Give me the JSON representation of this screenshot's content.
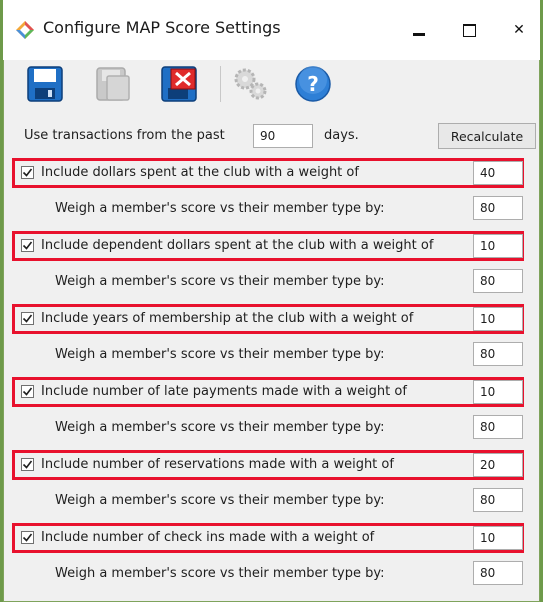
{
  "window": {
    "title": "Configure MAP Score Settings",
    "buttons": {
      "minimize": "▬",
      "maximize": "☐",
      "close": "✕"
    }
  },
  "toolbar": {
    "items": [
      {
        "icon": "save-icon",
        "enabled": true
      },
      {
        "icon": "save-copy-icon",
        "enabled": false
      },
      {
        "icon": "delete-icon",
        "enabled": true
      },
      {
        "icon": "gears-icon",
        "enabled": false
      },
      {
        "icon": "help-icon",
        "enabled": true
      }
    ]
  },
  "transactions": {
    "prefix": "Use transactions from the past",
    "value": "90",
    "suffix": "days.",
    "recalculate_label": "Recalculate"
  },
  "criteria": [
    {
      "label": "Include dollars spent at the club with a weight of",
      "checked": true,
      "weight": "40",
      "sub_label": "Weigh a member's score vs their member type by:",
      "sub_value": "80"
    },
    {
      "label": "Include dependent dollars spent at the club with a weight of",
      "checked": true,
      "weight": "10",
      "sub_label": "Weigh a member's score vs their member type by:",
      "sub_value": "80"
    },
    {
      "label": "Include years of membership at the club with a weight of",
      "checked": true,
      "weight": "10",
      "sub_label": "Weigh a member's score vs their member type by:",
      "sub_value": "80"
    },
    {
      "label": "Include number of late payments made with a weight of",
      "checked": true,
      "weight": "10",
      "sub_label": "Weigh a member's score vs their member type by:",
      "sub_value": "80"
    },
    {
      "label": "Include number of reservations made with a weight of",
      "checked": true,
      "weight": "20",
      "sub_label": "Weigh a member's score vs their member type by:",
      "sub_value": "80"
    },
    {
      "label": "Include number of check ins made with a weight of",
      "checked": true,
      "weight": "10",
      "sub_label": "Weigh a member's score vs their member type by:",
      "sub_value": "80"
    }
  ],
  "colors": {
    "highlight": "#e8112d",
    "window_border": "#7fa35c"
  }
}
